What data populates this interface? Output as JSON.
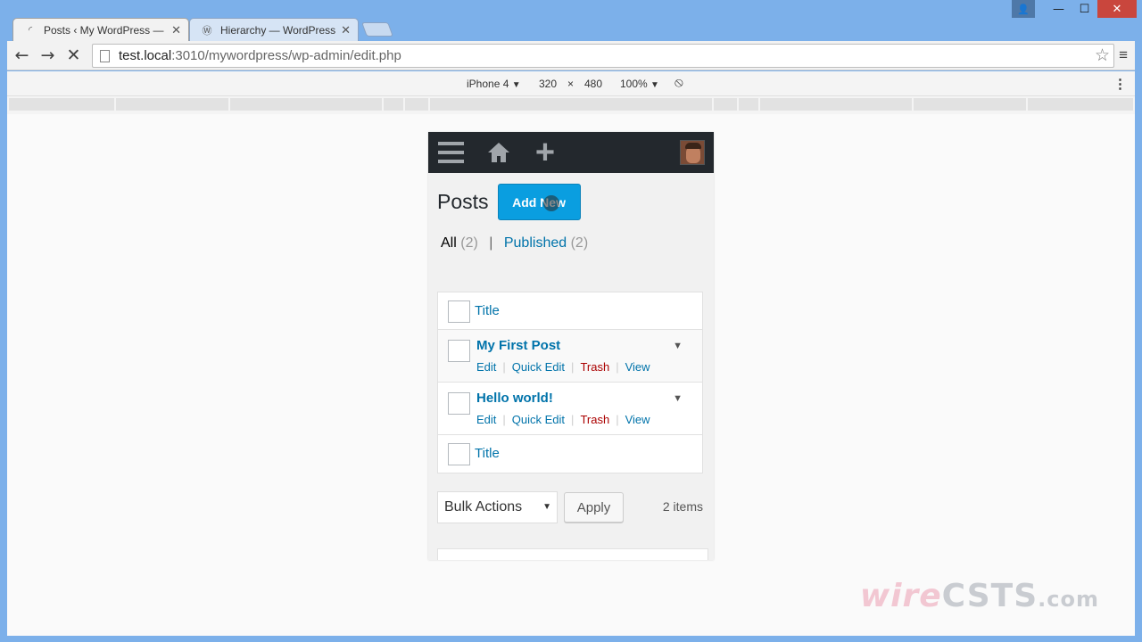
{
  "window": {
    "controls": {
      "user": "👤",
      "minimize": "—",
      "maximize": "☐",
      "close": "✕"
    }
  },
  "tabs": [
    {
      "label": "Posts ‹ My WordPress — ",
      "favicon": "loading-spinner-icon",
      "close": "✕"
    },
    {
      "label": "Hierarchy — WordPress P",
      "favicon": "wordpress-icon",
      "close": "✕"
    }
  ],
  "toolbar": {
    "back": "←",
    "forward": "→",
    "stop": "✕",
    "url_host": "test.local",
    "url_path": ":3010/mywordpress/wp-admin/edit.php",
    "star": "☆",
    "menu": "≡"
  },
  "devbar": {
    "device": "iPhone 4",
    "width": "320",
    "times": "×",
    "height": "480",
    "zoom": "100%",
    "dropdown_arrow": "▼",
    "rotate": "⦸",
    "more": "⋮"
  },
  "wp": {
    "adminbar": {
      "plus": "+"
    },
    "page_title": "Posts",
    "add_new": "Add New",
    "filters": {
      "all_label": "All",
      "all_count": "(2)",
      "separator": "|",
      "published_label": "Published",
      "published_count": "(2)"
    },
    "table": {
      "column_title": "Title",
      "rows": [
        {
          "title": "My First Post",
          "actions": [
            "Edit",
            "Quick Edit",
            "Trash",
            "View"
          ]
        },
        {
          "title": "Hello world!",
          "actions": [
            "Edit",
            "Quick Edit",
            "Trash",
            "View"
          ]
        }
      ],
      "footer_title": "Title",
      "pipe": "|",
      "toggle": "▼"
    },
    "bulk_actions": "Bulk Actions",
    "bulk_arrow": "▼",
    "apply": "Apply",
    "item_count": "2 items"
  },
  "watermark": {
    "part1": "wire",
    "part2": "C",
    "part3": "STS",
    "part4": ".com"
  }
}
